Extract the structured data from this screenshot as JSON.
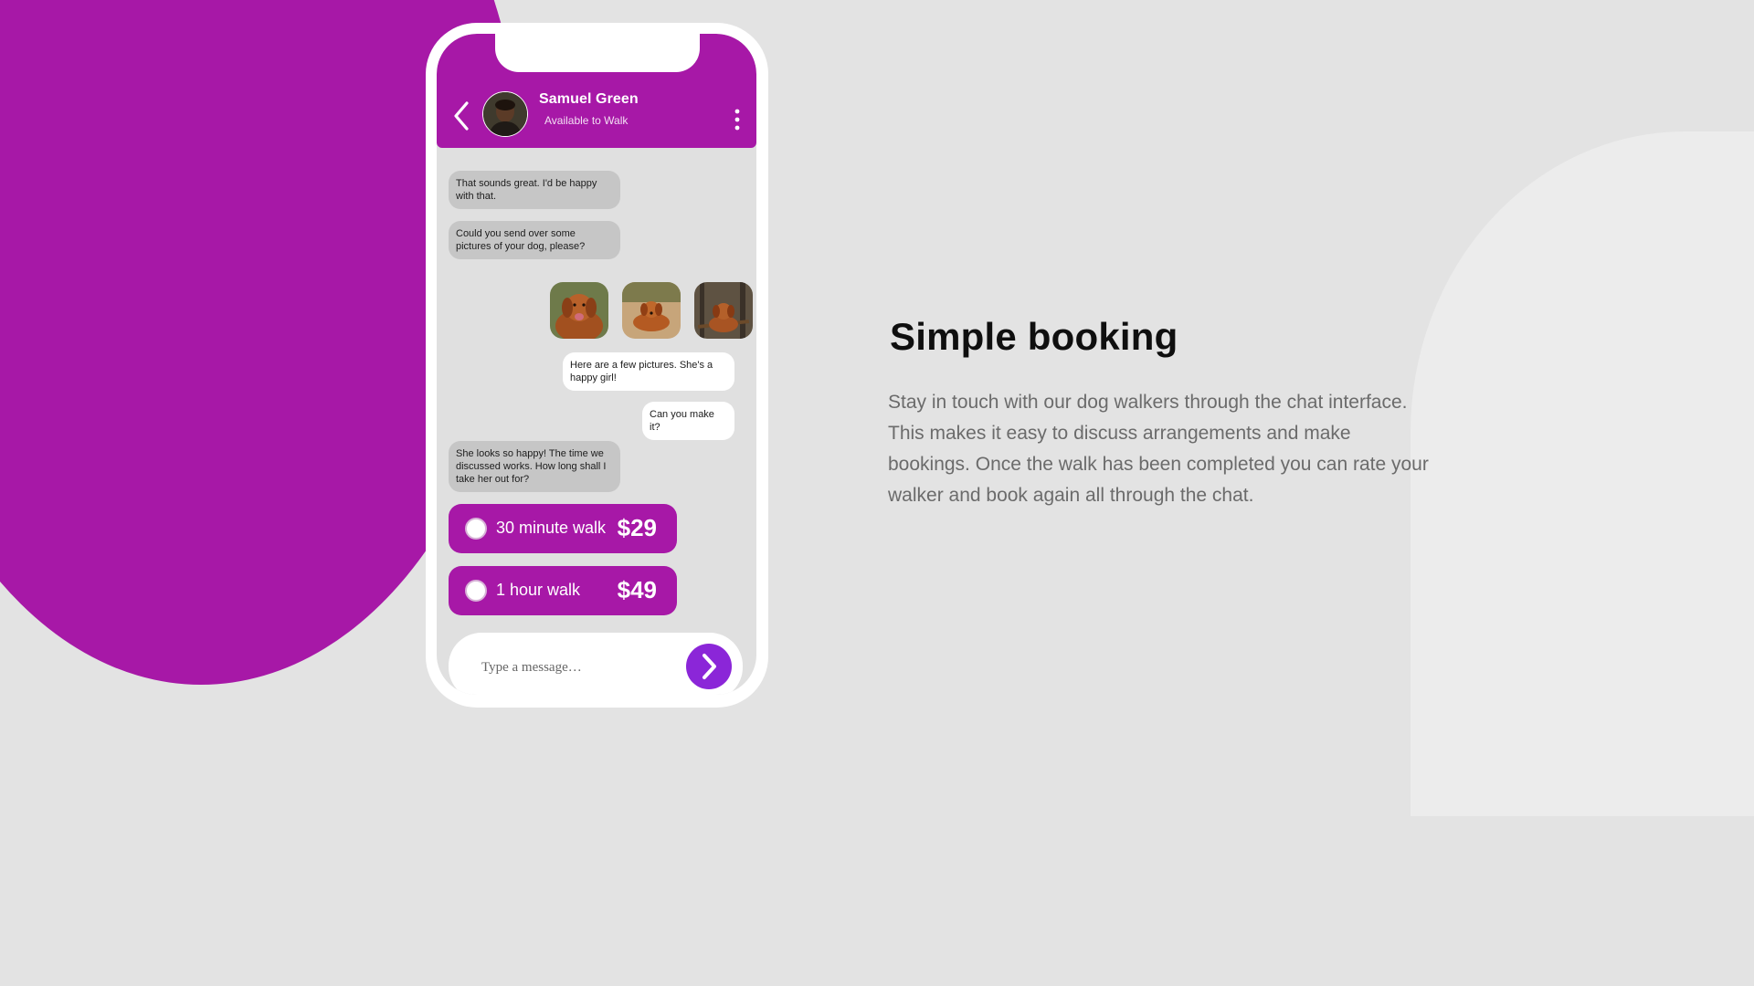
{
  "colors": {
    "brand_purple": "#a718a7",
    "send_button": "#8b26d8",
    "background": "#e3e3e3",
    "incoming_bubble": "#c6c6c6",
    "outgoing_bubble": "#ffffff"
  },
  "chat": {
    "contact": {
      "name": "Samuel Green",
      "status": "Available to Walk"
    },
    "icons": {
      "back": "chevron-left-icon",
      "more": "vertical-dots-icon",
      "send": "chevron-right-icon"
    },
    "messages": [
      {
        "from": "walker",
        "text": "That sounds great. I'd be happy with that."
      },
      {
        "from": "walker",
        "text": "Could you send over some pictures of your dog, please?"
      },
      {
        "from": "owner",
        "text": "Here are a few pictures. She's a happy girl!"
      },
      {
        "from": "owner",
        "text": "Can you make it?"
      },
      {
        "from": "walker",
        "text": "She looks so happy! The time we discussed works. How long shall I take her out for?"
      }
    ],
    "photos": [
      "dog-photo-1",
      "dog-photo-2",
      "dog-photo-3"
    ],
    "options": [
      {
        "label": "30 minute walk",
        "price": "$29"
      },
      {
        "label": "1 hour walk",
        "price": "$49"
      }
    ],
    "composer": {
      "placeholder": "Type a message…"
    }
  },
  "section": {
    "title": "Simple booking",
    "description": "Stay in touch with our dog walkers through the chat interface. This makes it easy to discuss arrangements and make bookings. Once the walk has been completed you can rate your walker and book again all through the chat."
  }
}
